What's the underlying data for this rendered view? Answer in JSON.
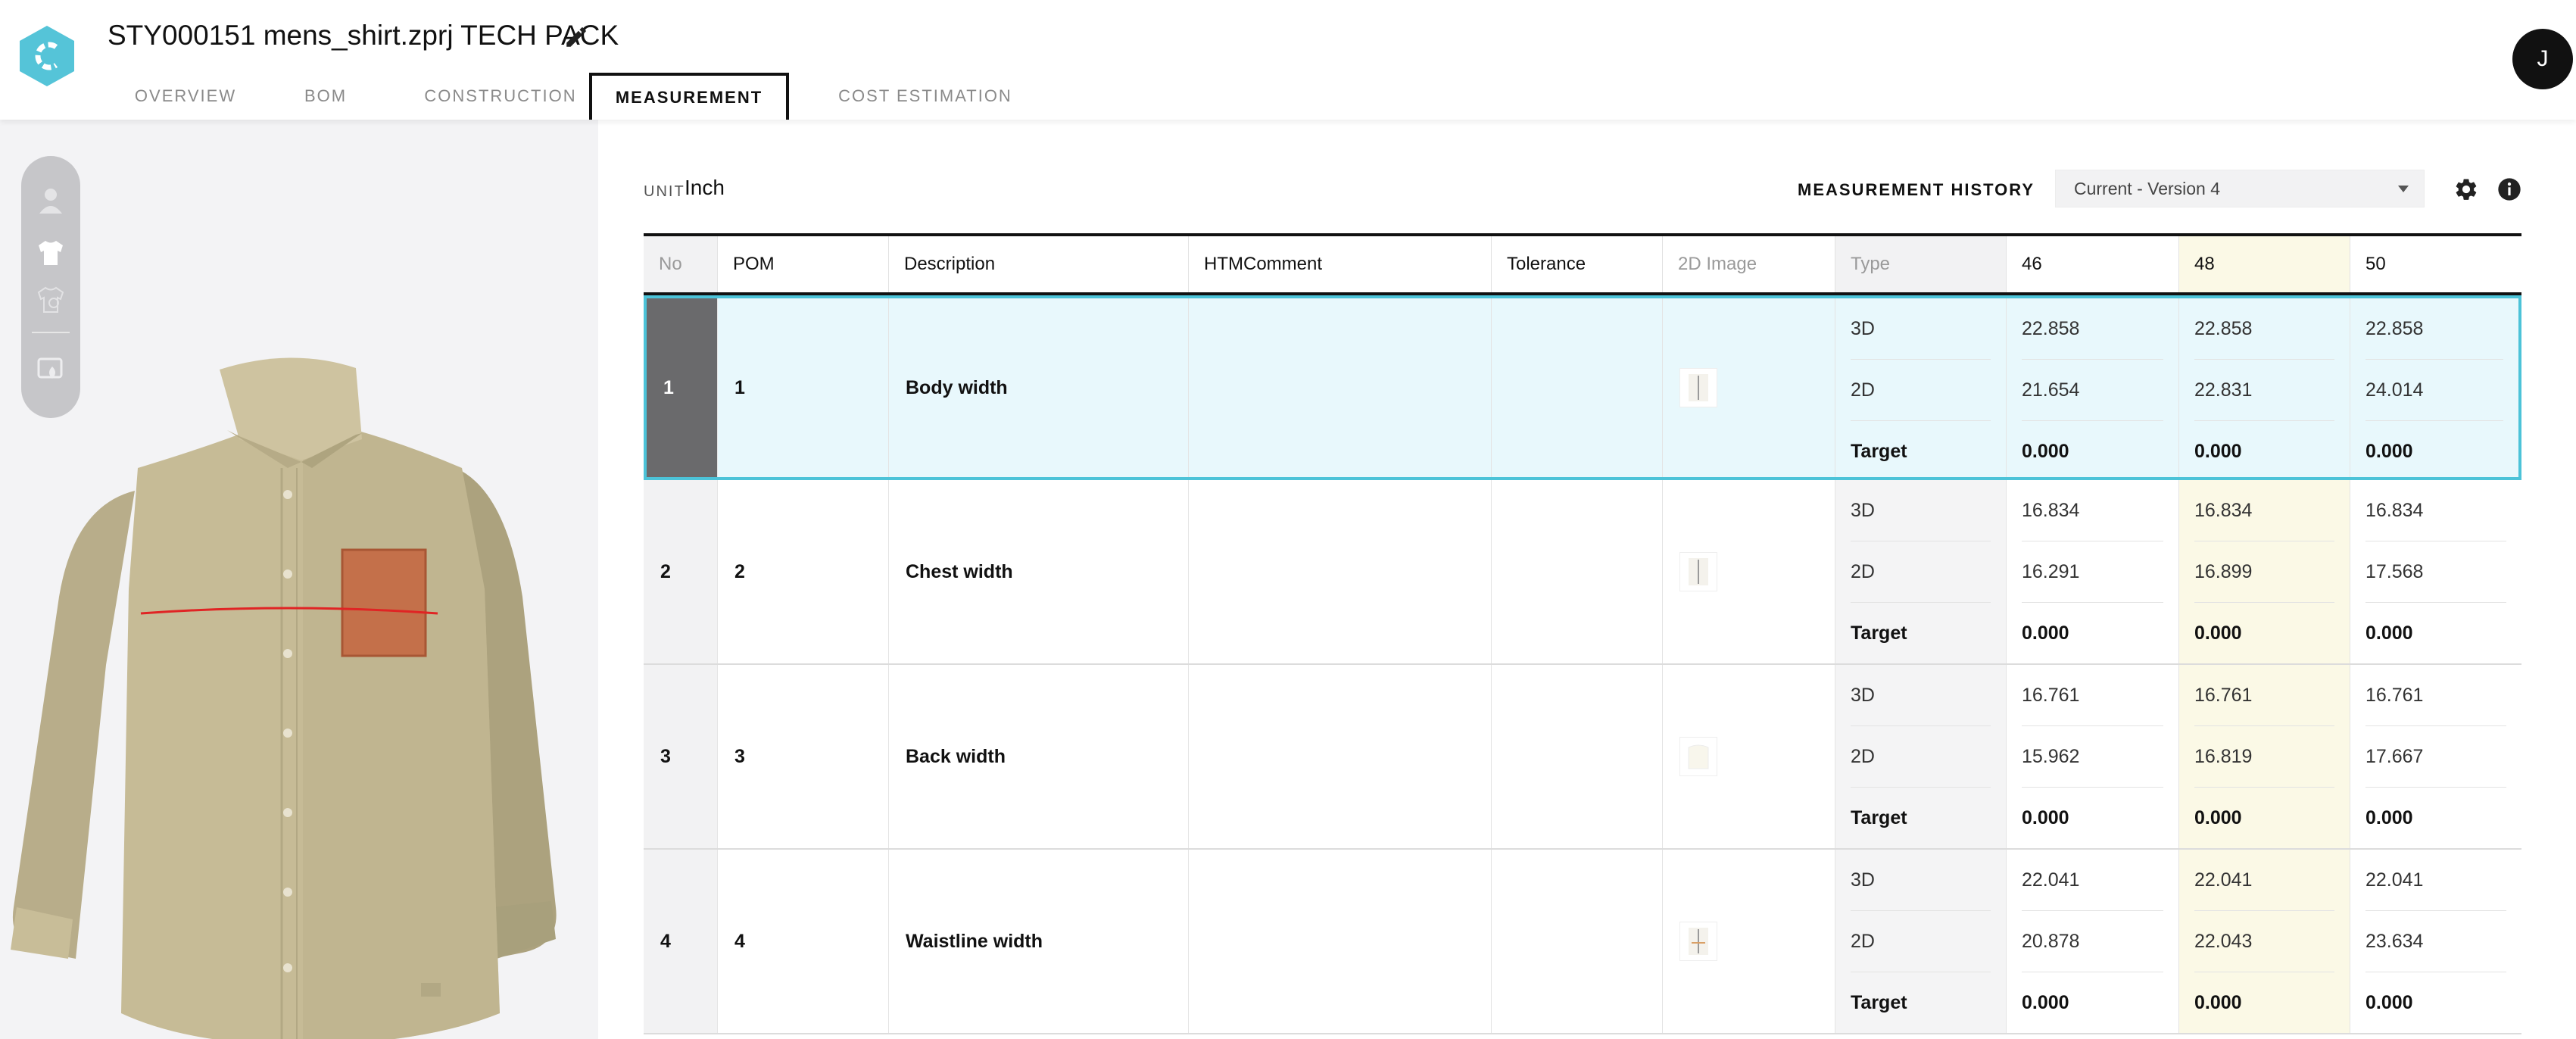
{
  "app": {
    "title": "STY000151 mens_shirt.zprj TECH PACK",
    "logo_icon": "clo-logo-icon",
    "accent_color": "#4cc3d8"
  },
  "tabs": [
    {
      "label": "OVERVIEW",
      "active": false
    },
    {
      "label": "BOM",
      "active": false
    },
    {
      "label": "CONSTRUCTION",
      "active": false
    },
    {
      "label": "MEASUREMENT",
      "active": true
    },
    {
      "label": "COST ESTIMATION",
      "active": false
    }
  ],
  "user": {
    "initial": "J"
  },
  "viewer": {
    "tools": [
      "avatar-icon",
      "garment-icon",
      "colorway-icon",
      "render-icon"
    ],
    "active_tool": "garment-icon"
  },
  "measurement": {
    "unit_label": "UNIT",
    "unit_value": "Inch",
    "history_label": "MEASUREMENT HISTORY",
    "history_value": "Current - Version 4",
    "columns": [
      "No",
      "POM",
      "Description",
      "HTMComment",
      "Tolerance",
      "2D Image",
      "Type",
      "46",
      "48",
      "50"
    ],
    "selected_size": "48",
    "rows": [
      {
        "no": "1",
        "pom": "1",
        "description": "Body width",
        "comment": "",
        "tolerance": "",
        "selected": true,
        "types": [
          "3D",
          "2D",
          "Target"
        ],
        "values": {
          "46": [
            "22.858",
            "21.654",
            "0.000"
          ],
          "48": [
            "22.858",
            "22.831",
            "0.000"
          ],
          "50": [
            "22.858",
            "24.014",
            "0.000"
          ]
        }
      },
      {
        "no": "2",
        "pom": "2",
        "description": "Chest width",
        "comment": "",
        "tolerance": "",
        "selected": false,
        "types": [
          "3D",
          "2D",
          "Target"
        ],
        "values": {
          "46": [
            "16.834",
            "16.291",
            "0.000"
          ],
          "48": [
            "16.834",
            "16.899",
            "0.000"
          ],
          "50": [
            "16.834",
            "17.568",
            "0.000"
          ]
        }
      },
      {
        "no": "3",
        "pom": "3",
        "description": "Back width",
        "comment": "",
        "tolerance": "",
        "selected": false,
        "types": [
          "3D",
          "2D",
          "Target"
        ],
        "values": {
          "46": [
            "16.761",
            "15.962",
            "0.000"
          ],
          "48": [
            "16.761",
            "16.819",
            "0.000"
          ],
          "50": [
            "16.761",
            "17.667",
            "0.000"
          ]
        }
      },
      {
        "no": "4",
        "pom": "4",
        "description": "Waistline width",
        "comment": "",
        "tolerance": "",
        "selected": false,
        "types": [
          "3D",
          "2D",
          "Target"
        ],
        "values": {
          "46": [
            "22.041",
            "20.878",
            "0.000"
          ],
          "48": [
            "22.041",
            "22.043",
            "0.000"
          ],
          "50": [
            "22.041",
            "23.634",
            "0.000"
          ]
        }
      }
    ]
  }
}
